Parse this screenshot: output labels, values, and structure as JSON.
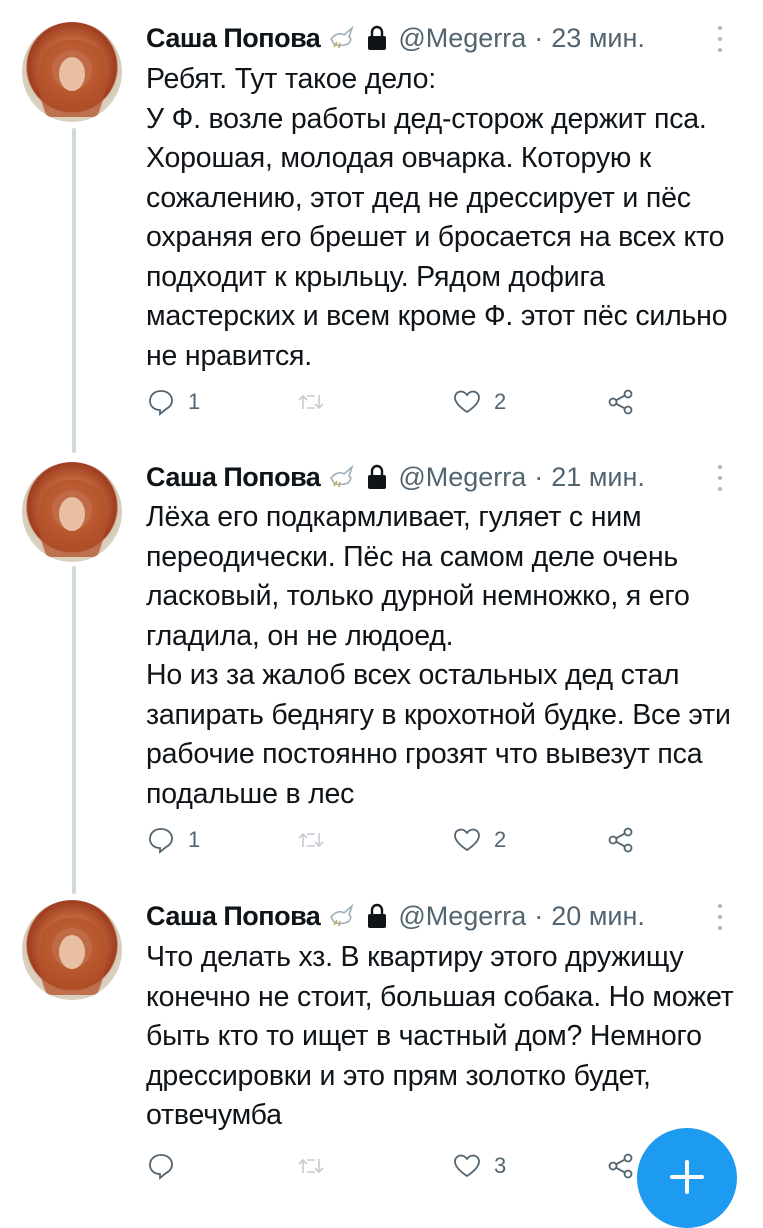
{
  "tweets": [
    {
      "name": "Саша Попова",
      "handle": "@Megerra",
      "separator": "·",
      "time": "23 мин.",
      "text": "Ребят. Тут такое дело:\nУ Ф. возле работы дед-сторож держит пса. Хорошая, молодая овчарка. Которую к сожалению, этот  дед не дрессирует и пёс охраняя его брешет и бросается на всех кто подходит к крыльцу. Рядом дофига мастерских и всем кроме Ф. этот пёс сильно не нравится.",
      "replies": "1",
      "retweets": "",
      "likes": "2"
    },
    {
      "name": "Саша Попова",
      "handle": "@Megerra",
      "separator": "·",
      "time": "21 мин.",
      "text": "Лёха его подкармливает, гуляет с ним переодически. Пёс на самом деле очень ласковый, только дурной немножко, я его гладила, он не людоед.\n Но из за жалоб всех остальных дед стал запирать беднягу в крохотной будке. Все эти рабочие постоянно грозят что вывезут пса подальше в лес",
      "replies": "1",
      "retweets": "",
      "likes": "2"
    },
    {
      "name": "Саша Попова",
      "handle": "@Megerra",
      "separator": "·",
      "time": "20 мин.",
      "text": "Что делать хз. В квартиру этого дружищу конечно не стоит, большая собака. Но может быть кто то ищет в частный дом? Немного дрессировки и это прям золотко будет, отвечумба",
      "replies": "",
      "retweets": "",
      "likes": "3"
    }
  ],
  "icons": {
    "reply": "reply-icon",
    "retweet": "retweet-icon",
    "like": "heart-icon",
    "share": "share-icon",
    "compose": "plus-icon",
    "badge": "dove-icon",
    "protected": "lock-icon"
  },
  "colors": {
    "accent": "#1d9bf0",
    "secondary_text": "#536471",
    "thread_line": "#cfd9de"
  }
}
